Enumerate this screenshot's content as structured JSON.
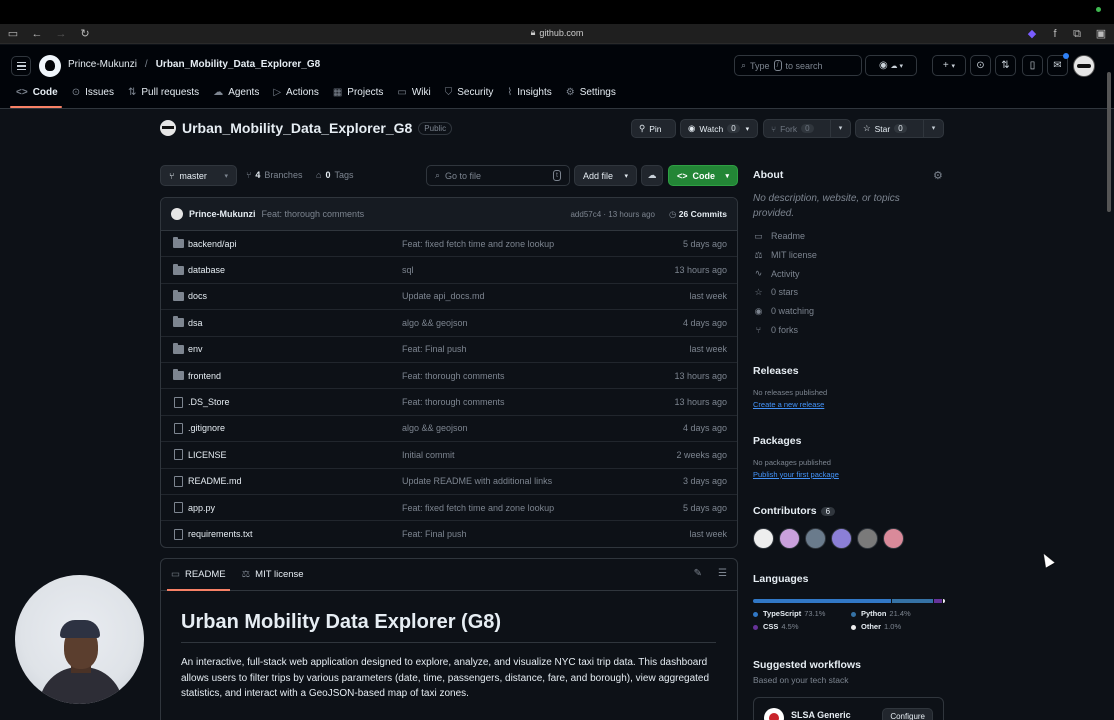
{
  "browser": {
    "url": "github.com"
  },
  "header": {
    "owner": "Prince-Mukunzi",
    "separator": "/",
    "repo": "Urban_Mobility_Data_Explorer_G8",
    "search_prefix": "Type",
    "search_key": "/",
    "search_suffix": "to search",
    "plus": "+"
  },
  "nav": {
    "tabs": [
      {
        "label": "Code",
        "icon": "code-icon"
      },
      {
        "label": "Issues",
        "icon": "issue-icon"
      },
      {
        "label": "Pull requests",
        "icon": "pull-request-icon"
      },
      {
        "label": "Agents",
        "icon": "agents-icon"
      },
      {
        "label": "Actions",
        "icon": "actions-icon"
      },
      {
        "label": "Projects",
        "icon": "projects-icon"
      },
      {
        "label": "Wiki",
        "icon": "wiki-icon"
      },
      {
        "label": "Security",
        "icon": "shield-icon"
      },
      {
        "label": "Insights",
        "icon": "graph-icon"
      },
      {
        "label": "Settings",
        "icon": "gear-icon"
      }
    ]
  },
  "repo": {
    "name": "Urban_Mobility_Data_Explorer_G8",
    "visibility": "Public",
    "pin": "Pin",
    "watch": "Watch",
    "watch_count": "0",
    "fork": "Fork",
    "fork_count": "0",
    "star": "Star",
    "star_count": "0"
  },
  "toolbar": {
    "branch": "master",
    "branches_count": "4",
    "branches_label": "Branches",
    "tags_count": "0",
    "tags_label": "Tags",
    "goto_placeholder": "Go to file",
    "goto_key": "t",
    "add_file": "Add file",
    "code": "Code"
  },
  "latest_commit": {
    "author": "Prince-Mukunzi",
    "message": "Feat: thorough comments",
    "sha_time": "add57c4 · 13 hours ago",
    "commits_count": "26",
    "commits_label": "Commits"
  },
  "files": [
    {
      "name": "backend/api",
      "type": "dir",
      "message": "Feat: fixed fetch time and zone lookup",
      "time": "5 days ago"
    },
    {
      "name": "database",
      "type": "dir",
      "message": "sql",
      "time": "13 hours ago"
    },
    {
      "name": "docs",
      "type": "dir",
      "message": "Update api_docs.md",
      "time": "last week"
    },
    {
      "name": "dsa",
      "type": "dir",
      "message": "algo && geojson",
      "time": "4 days ago"
    },
    {
      "name": "env",
      "type": "dir",
      "message": "Feat: Final push",
      "time": "last week"
    },
    {
      "name": "frontend",
      "type": "dir",
      "message": "Feat: thorough comments",
      "time": "13 hours ago"
    },
    {
      "name": ".DS_Store",
      "type": "file",
      "message": "Feat: thorough comments",
      "time": "13 hours ago"
    },
    {
      "name": ".gitignore",
      "type": "file",
      "message": "algo && geojson",
      "time": "4 days ago"
    },
    {
      "name": "LICENSE",
      "type": "file",
      "message": "Initial commit",
      "time": "2 weeks ago"
    },
    {
      "name": "README.md",
      "type": "file",
      "message": "Update README with additional links",
      "time": "3 days ago"
    },
    {
      "name": "app.py",
      "type": "file",
      "message": "Feat: fixed fetch time and zone lookup",
      "time": "5 days ago"
    },
    {
      "name": "requirements.txt",
      "type": "file",
      "message": "Feat: Final push",
      "time": "last week"
    }
  ],
  "readme": {
    "tab_readme": "README",
    "tab_license": "MIT license",
    "title": "Urban Mobility Data Explorer (G8)",
    "body": "An interactive, full-stack web application designed to explore, analyze, and visualize NYC taxi trip data. This dashboard allows users to filter trips by various parameters (date, time, passengers, distance, fare, and borough), view aggregated statistics, and interact with a GeoJSON-based map of taxi zones."
  },
  "about": {
    "title": "About",
    "description": "No description, website, or topics provided.",
    "links": [
      {
        "label": "Readme",
        "icon": "book-icon"
      },
      {
        "label": "MIT license",
        "icon": "law-icon"
      },
      {
        "label": "Activity",
        "icon": "pulse-icon"
      },
      {
        "label": "0 stars",
        "icon": "star-icon"
      },
      {
        "label": "0 watching",
        "icon": "eye-icon"
      },
      {
        "label": "0 forks",
        "icon": "fork-icon"
      }
    ]
  },
  "releases": {
    "title": "Releases",
    "none": "No releases published",
    "link": "Create a new release"
  },
  "packages": {
    "title": "Packages",
    "none": "No packages published",
    "link": "Publish your first package"
  },
  "contributors": {
    "title": "Contributors",
    "count": "6"
  },
  "languages": {
    "title": "Languages",
    "items": [
      {
        "name": "TypeScript",
        "percent": "73.1%",
        "value": 73.1,
        "color": "#3178c6"
      },
      {
        "name": "Python",
        "percent": "21.4%",
        "value": 21.4,
        "color": "#3572A5"
      },
      {
        "name": "CSS",
        "percent": "4.5%",
        "value": 4.5,
        "color": "#663399"
      },
      {
        "name": "Other",
        "percent": "1.0%",
        "value": 1.0,
        "color": "#ededed"
      }
    ]
  },
  "workflows": {
    "title": "Suggested workflows",
    "subtitle": "Based on your tech stack",
    "card_name": "SLSA Generic",
    "card_button": "Configure"
  }
}
